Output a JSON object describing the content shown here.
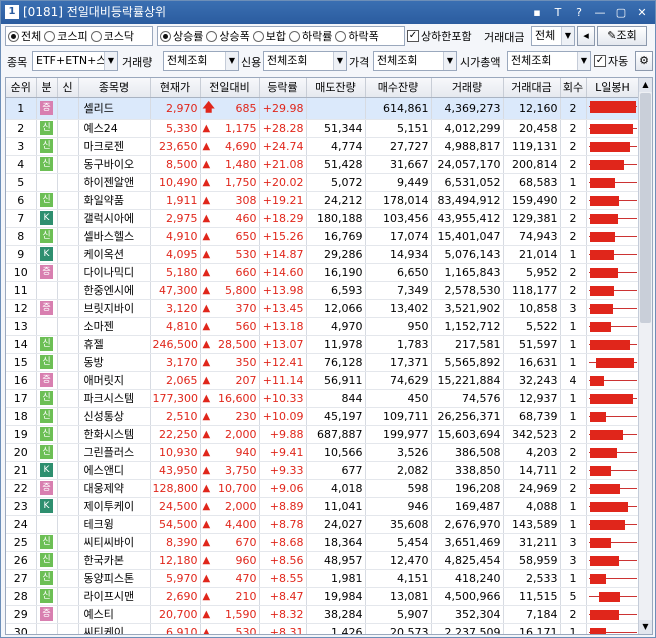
{
  "window": {
    "num": "1",
    "title": "[0181] 전일대비등락률상위",
    "btns": [
      "▪",
      "T",
      "?",
      "—",
      "▢",
      "✕"
    ]
  },
  "market_radios": [
    {
      "label": "전체",
      "on": true
    },
    {
      "label": "코스피",
      "on": false
    },
    {
      "label": "코스닥",
      "on": false
    }
  ],
  "sort_radios": [
    {
      "label": "상승률",
      "on": true
    },
    {
      "label": "상승폭",
      "on": false
    },
    {
      "label": "보합",
      "on": false
    },
    {
      "label": "하락률",
      "on": false
    },
    {
      "label": "하락폭",
      "on": false
    }
  ],
  "toolbar": {
    "upper_limit_label": "상하한포함",
    "upper_limit_checked": "✓",
    "amount_label": "거래대금",
    "amount_value": "전체",
    "query_btn": "조회",
    "item_label": "종목",
    "item_value": "ETF+ETN+스",
    "volume_label": "거래량",
    "volume_value": "전체조회",
    "credit_label": "신용",
    "credit_value": "전체조회",
    "price_label": "가격",
    "price_value": "전체조회",
    "cap_label": "시가총액",
    "cap_value": "전체조회",
    "auto_label": "자동",
    "auto_checked": "✓",
    "gear": "⚙"
  },
  "columns": [
    "순위",
    "분",
    "신",
    "종목명",
    "현재가",
    "전일대비",
    "등락률",
    "매도잔량",
    "매수잔량",
    "거래량",
    "거래대금",
    "회수",
    "L일봉H"
  ],
  "rows": [
    {
      "rank": "1",
      "cat": "증",
      "tri": false,
      "name": "셀리드",
      "price": "2,970",
      "arrow": "up",
      "change": "685",
      "rate": "+29.98",
      "ask": "",
      "bid": "614,861",
      "vol": "4,369,273",
      "amt": "12,160",
      "cnt": "2",
      "cs": 0.0,
      "ce": 0.98,
      "big": true
    },
    {
      "rank": "2",
      "cat": "신",
      "tri": false,
      "name": "예스24",
      "price": "5,330",
      "arrow": "tri",
      "change": "1,175",
      "rate": "+28.28",
      "ask": "51,344",
      "bid": "5,151",
      "vol": "4,012,299",
      "amt": "20,458",
      "cnt": "2",
      "cs": 0.02,
      "ce": 0.93
    },
    {
      "rank": "3",
      "cat": "신",
      "tri": true,
      "name": "마크로젠",
      "price": "23,650",
      "arrow": "tri",
      "change": "4,690",
      "rate": "+24.74",
      "ask": "4,774",
      "bid": "27,727",
      "vol": "4,988,817",
      "amt": "119,131",
      "cnt": "2",
      "cs": 0.02,
      "ce": 0.86
    },
    {
      "rank": "4",
      "cat": "신",
      "tri": false,
      "name": "동구바이오",
      "price": "8,500",
      "arrow": "tri",
      "change": "1,480",
      "rate": "+21.08",
      "ask": "51,428",
      "bid": "31,667",
      "vol": "24,057,170",
      "amt": "200,814",
      "cnt": "2",
      "cs": 0.02,
      "ce": 0.74
    },
    {
      "rank": "5",
      "cat": "",
      "tri": false,
      "name": "하이젠알앤",
      "price": "10,490",
      "arrow": "tri",
      "change": "1,750",
      "rate": "+20.02",
      "ask": "5,072",
      "bid": "9,449",
      "vol": "6,531,052",
      "amt": "68,583",
      "cnt": "1",
      "cs": 0.02,
      "ce": 0.55
    },
    {
      "rank": "6",
      "cat": "신",
      "tri": false,
      "name": "화일약품",
      "price": "1,911",
      "arrow": "tri",
      "change": "308",
      "rate": "+19.21",
      "ask": "24,212",
      "bid": "178,014",
      "vol": "83,494,912",
      "amt": "159,490",
      "cnt": "2",
      "cs": 0.02,
      "ce": 0.62
    },
    {
      "rank": "7",
      "cat": "K",
      "tri": false,
      "name": "갤럭시아에",
      "price": "2,975",
      "arrow": "tri",
      "change": "460",
      "rate": "+18.29",
      "ask": "180,188",
      "bid": "103,456",
      "vol": "43,955,412",
      "amt": "129,381",
      "cnt": "2",
      "cs": 0.02,
      "ce": 0.6
    },
    {
      "rank": "8",
      "cat": "신",
      "tri": false,
      "name": "셀바스헬스",
      "price": "4,910",
      "arrow": "tri",
      "change": "650",
      "rate": "+15.26",
      "ask": "16,769",
      "bid": "17,074",
      "vol": "15,401,047",
      "amt": "74,943",
      "cnt": "2",
      "cs": 0.02,
      "ce": 0.55
    },
    {
      "rank": "9",
      "cat": "K",
      "tri": false,
      "name": "케이옥션",
      "price": "4,095",
      "arrow": "tri",
      "change": "530",
      "rate": "+14.87",
      "ask": "29,286",
      "bid": "14,934",
      "vol": "5,076,143",
      "amt": "21,014",
      "cnt": "1",
      "cs": 0.02,
      "ce": 0.52
    },
    {
      "rank": "10",
      "cat": "증",
      "tri": false,
      "name": "다이나믹디",
      "price": "5,180",
      "arrow": "tri",
      "change": "660",
      "rate": "+14.60",
      "ask": "16,190",
      "bid": "6,650",
      "vol": "1,165,843",
      "amt": "5,952",
      "cnt": "2",
      "cs": 0.02,
      "ce": 0.6
    },
    {
      "rank": "11",
      "cat": "",
      "tri": false,
      "name": "한중엔시에",
      "price": "47,300",
      "arrow": "tri",
      "change": "5,800",
      "rate": "+13.98",
      "ask": "6,593",
      "bid": "7,349",
      "vol": "2,578,530",
      "amt": "118,177",
      "cnt": "2",
      "cs": 0.02,
      "ce": 0.52
    },
    {
      "rank": "12",
      "cat": "증",
      "tri": false,
      "name": "브릿지바이",
      "price": "3,120",
      "arrow": "tri",
      "change": "370",
      "rate": "+13.45",
      "ask": "12,066",
      "bid": "13,402",
      "vol": "3,521,902",
      "amt": "10,858",
      "cnt": "3",
      "cs": 0.02,
      "ce": 0.5
    },
    {
      "rank": "13",
      "cat": "",
      "tri": true,
      "name": "소마젠",
      "price": "4,810",
      "arrow": "tri",
      "change": "560",
      "rate": "+13.18",
      "ask": "4,970",
      "bid": "950",
      "vol": "1,152,712",
      "amt": "5,522",
      "cnt": "1",
      "cs": 0.02,
      "ce": 0.45
    },
    {
      "rank": "14",
      "cat": "신",
      "tri": false,
      "name": "휴젤",
      "price": "246,500",
      "arrow": "tri",
      "change": "28,500",
      "rate": "+13.07",
      "ask": "11,978",
      "bid": "1,783",
      "vol": "217,581",
      "amt": "51,597",
      "cnt": "1",
      "cs": 0.02,
      "ce": 0.86
    },
    {
      "rank": "15",
      "cat": "신",
      "tri": false,
      "name": "동방",
      "price": "3,170",
      "arrow": "tri",
      "change": "350",
      "rate": "+12.41",
      "ask": "76,128",
      "bid": "17,371",
      "vol": "5,565,892",
      "amt": "16,631",
      "cnt": "1",
      "cs": 0.14,
      "ce": 0.95
    },
    {
      "rank": "16",
      "cat": "증",
      "tri": false,
      "name": "애머릿지",
      "price": "2,065",
      "arrow": "tri",
      "change": "207",
      "rate": "+11.14",
      "ask": "56,911",
      "bid": "74,629",
      "vol": "15,221,884",
      "amt": "32,243",
      "cnt": "4",
      "cs": 0.02,
      "ce": 0.3
    },
    {
      "rank": "17",
      "cat": "신",
      "tri": false,
      "name": "파크시스템",
      "price": "177,300",
      "arrow": "tri",
      "change": "16,600",
      "rate": "+10.33",
      "ask": "844",
      "bid": "450",
      "vol": "74,576",
      "amt": "12,937",
      "cnt": "1",
      "cs": 0.02,
      "ce": 0.92
    },
    {
      "rank": "18",
      "cat": "신",
      "tri": false,
      "name": "신성통상",
      "price": "2,510",
      "arrow": "tri",
      "change": "230",
      "rate": "+10.09",
      "ask": "45,197",
      "bid": "109,711",
      "vol": "26,256,371",
      "amt": "68,739",
      "cnt": "1",
      "cs": 0.02,
      "ce": 0.35
    },
    {
      "rank": "19",
      "cat": "신",
      "tri": false,
      "name": "한화시스템",
      "price": "22,250",
      "arrow": "tri",
      "change": "2,000",
      "rate": "+9.88",
      "ask": "687,887",
      "bid": "199,977",
      "vol": "15,603,694",
      "amt": "342,523",
      "cnt": "2",
      "cs": 0.02,
      "ce": 0.72
    },
    {
      "rank": "20",
      "cat": "신",
      "tri": false,
      "name": "그린플러스",
      "price": "10,930",
      "arrow": "tri",
      "change": "940",
      "rate": "+9.41",
      "ask": "10,566",
      "bid": "3,526",
      "vol": "386,508",
      "amt": "4,203",
      "cnt": "2",
      "cs": 0.02,
      "ce": 0.58
    },
    {
      "rank": "21",
      "cat": "K",
      "tri": false,
      "name": "에스앤디",
      "price": "43,950",
      "arrow": "tri",
      "change": "3,750",
      "rate": "+9.33",
      "ask": "677",
      "bid": "2,082",
      "vol": "338,850",
      "amt": "14,711",
      "cnt": "2",
      "cs": 0.02,
      "ce": 0.45
    },
    {
      "rank": "22",
      "cat": "증",
      "tri": false,
      "name": "대웅제약",
      "price": "128,800",
      "arrow": "tri",
      "change": "10,700",
      "rate": "+9.06",
      "ask": "4,018",
      "bid": "598",
      "vol": "196,208",
      "amt": "24,969",
      "cnt": "2",
      "cs": 0.02,
      "ce": 0.65
    },
    {
      "rank": "23",
      "cat": "K",
      "tri": false,
      "name": "제이투케이",
      "price": "24,500",
      "arrow": "tri",
      "change": "2,000",
      "rate": "+8.89",
      "ask": "11,041",
      "bid": "946",
      "vol": "169,487",
      "amt": "4,088",
      "cnt": "1",
      "cs": 0.02,
      "ce": 0.82
    },
    {
      "rank": "24",
      "cat": "",
      "tri": false,
      "name": "테크윙",
      "price": "54,500",
      "arrow": "tri",
      "change": "4,400",
      "rate": "+8.78",
      "ask": "24,027",
      "bid": "35,608",
      "vol": "2,676,970",
      "amt": "143,589",
      "cnt": "1",
      "cs": 0.02,
      "ce": 0.75
    },
    {
      "rank": "25",
      "cat": "신",
      "tri": false,
      "name": "씨티씨바이",
      "price": "8,390",
      "arrow": "tri",
      "change": "670",
      "rate": "+8.68",
      "ask": "18,364",
      "bid": "5,454",
      "vol": "3,651,469",
      "amt": "31,211",
      "cnt": "3",
      "cs": 0.02,
      "ce": 0.45
    },
    {
      "rank": "26",
      "cat": "신",
      "tri": false,
      "name": "한국카본",
      "price": "12,180",
      "arrow": "tri",
      "change": "960",
      "rate": "+8.56",
      "ask": "48,957",
      "bid": "12,470",
      "vol": "4,825,454",
      "amt": "58,959",
      "cnt": "3",
      "cs": 0.02,
      "ce": 0.62
    },
    {
      "rank": "27",
      "cat": "신",
      "tri": false,
      "name": "동양피스톤",
      "price": "5,970",
      "arrow": "tri",
      "change": "470",
      "rate": "+8.55",
      "ask": "1,981",
      "bid": "4,151",
      "vol": "418,240",
      "amt": "2,533",
      "cnt": "1",
      "cs": 0.02,
      "ce": 0.35
    },
    {
      "rank": "28",
      "cat": "신",
      "tri": true,
      "name": "라이프시맨",
      "price": "2,690",
      "arrow": "tri",
      "change": "210",
      "rate": "+8.47",
      "ask": "19,984",
      "bid": "13,081",
      "vol": "4,500,966",
      "amt": "11,515",
      "cnt": "5",
      "cs": 0.2,
      "ce": 0.65
    },
    {
      "rank": "29",
      "cat": "증",
      "tri": false,
      "name": "예스티",
      "price": "20,700",
      "arrow": "tri",
      "change": "1,590",
      "rate": "+8.32",
      "ask": "38,284",
      "bid": "5,907",
      "vol": "352,304",
      "amt": "7,184",
      "cnt": "2",
      "cs": 0.02,
      "ce": 0.62
    },
    {
      "rank": "30",
      "cat": "",
      "tri": false,
      "name": "씨티케이",
      "price": "6,910",
      "arrow": "tri",
      "change": "530",
      "rate": "+8.31",
      "ask": "1,426",
      "bid": "20,573",
      "vol": "2,237,509",
      "amt": "16,171",
      "cnt": "1",
      "cs": 0.02,
      "ce": 0.35
    }
  ],
  "colors": {
    "up": "#e0261b",
    "zeung_tag": "#d87fb0",
    "shin_tag": "#6cbf55",
    "k_tag": "#2e8f6f",
    "selected_row": "#dbe9fb"
  }
}
